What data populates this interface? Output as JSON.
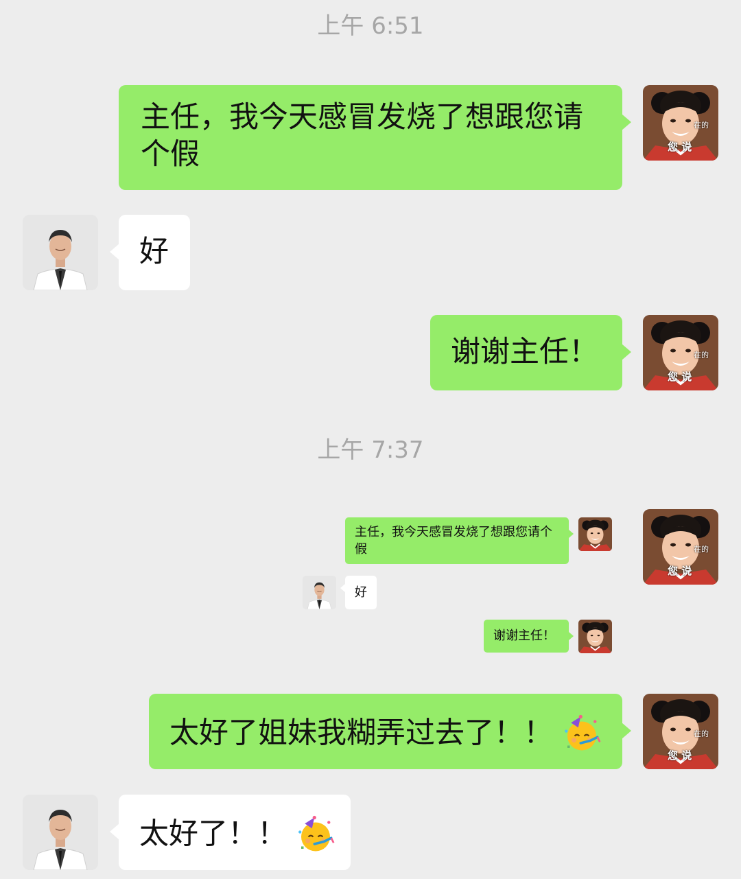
{
  "timestamps": [
    "上午 6:51",
    "上午 7:37"
  ],
  "messages": [
    {
      "sender": "me",
      "text": "主任，我今天感冒发烧了想跟您请个假"
    },
    {
      "sender": "boss",
      "text": "好"
    },
    {
      "sender": "me",
      "text": "谢谢主任！"
    },
    {
      "sender": "me",
      "text": "太好了姐妹我糊弄过去了！！",
      "emoji": "partying-face-emoji"
    },
    {
      "sender": "boss",
      "text": "太好了！！",
      "emoji": "partying-face-emoji"
    }
  ],
  "forwarded_screenshot": {
    "messages": [
      {
        "sender": "me",
        "text": "主任，我今天感冒发烧了想跟您请个假"
      },
      {
        "sender": "boss",
        "text": "好"
      },
      {
        "sender": "me",
        "text": "谢谢主任！"
      }
    ]
  },
  "avatars": {
    "me": {
      "icon": "girl-meme-avatar",
      "caption": "您 说",
      "side_text": "在的"
    },
    "boss": {
      "icon": "doctor-avatar"
    }
  },
  "colors": {
    "background": "#ededed",
    "my_bubble": "#95ec69",
    "their_bubble": "#ffffff",
    "timestamp": "#a6a6a6"
  }
}
